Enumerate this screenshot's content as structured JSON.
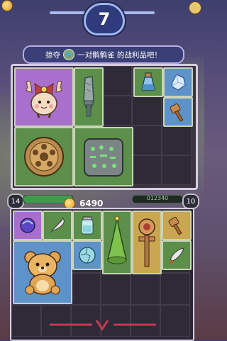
{
  "round": {
    "number": "7"
  },
  "banner": {
    "text_before": "掠夺",
    "text_after": "一对鹘鹘雀 的战利品吧！"
  },
  "player": {
    "level": "14",
    "hp_text": "",
    "gold": "6490"
  },
  "opponent": {
    "level": "10",
    "hp_text": "012340"
  },
  "icons": {
    "round": "round-badge",
    "opponent_avatar": "bird-icon",
    "gold": "coin-icon",
    "settings": "gear-icon"
  },
  "enemy_items": [
    {
      "name": "bow-fairy-plush",
      "color": "purple"
    },
    {
      "name": "stone-dagger",
      "color": "green"
    },
    {
      "name": "potion-bottle",
      "color": "green"
    },
    {
      "name": "crystal-shard",
      "color": "blue"
    },
    {
      "name": "wooden-mallet",
      "color": "blue"
    },
    {
      "name": "bronze-shield",
      "color": "green"
    },
    {
      "name": "rune-stone-tablet",
      "color": "green"
    }
  ],
  "player_items": [
    {
      "name": "purple-orb",
      "color": "purple"
    },
    {
      "name": "feather",
      "color": "green"
    },
    {
      "name": "glass-jar",
      "color": "green"
    },
    {
      "name": "green-cone-hat",
      "color": "green"
    },
    {
      "name": "wooden-target-dummy",
      "color": "yellow"
    },
    {
      "name": "wooden-mallet",
      "color": "yellow"
    },
    {
      "name": "teddy-bear",
      "color": "blue"
    },
    {
      "name": "cracked-orb",
      "color": "blue"
    },
    {
      "name": "leaf-blade",
      "color": "green"
    }
  ],
  "colors": {
    "panel_border": "#d8cde0",
    "green_slot": "#5b8f4a",
    "purple_slot": "#a96fcc",
    "blue_slot": "#5d93c9"
  }
}
